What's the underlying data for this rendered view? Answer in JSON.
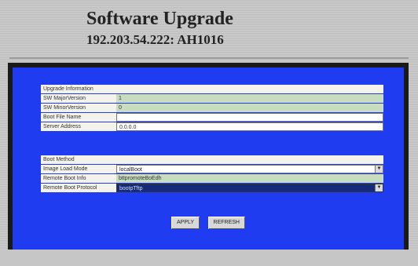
{
  "header": {
    "title": "Software Upgrade",
    "subtitle": "192.203.54.222: AH1016"
  },
  "upgrade_info": {
    "section_title": "Upgrade Information",
    "rows": [
      {
        "label": "SW MajorVersion",
        "value": "1"
      },
      {
        "label": "SW MinorVersion",
        "value": "0"
      },
      {
        "label": "Boot File Name",
        "value": ""
      },
      {
        "label": "Server Address",
        "value": "0.0.0.0"
      }
    ]
  },
  "boot_method": {
    "section_title": "Boot Method",
    "image_load_mode_label": "Image Load Mode",
    "image_load_mode_value": "localBoot",
    "remote_boot_info_label": "Remote Boot Info",
    "remote_boot_info_value": "bttpromoteBoEdh",
    "remote_boot_protocol_label": "Remote Boot Protocol",
    "remote_boot_protocol_value": "bootpTftp"
  },
  "buttons": {
    "apply": "APPLY",
    "refresh": "REFRESH"
  },
  "colors": {
    "panel": "#1f3cf0",
    "frame": "#1a1a1a",
    "readonly_field": "#c8dcc0"
  }
}
